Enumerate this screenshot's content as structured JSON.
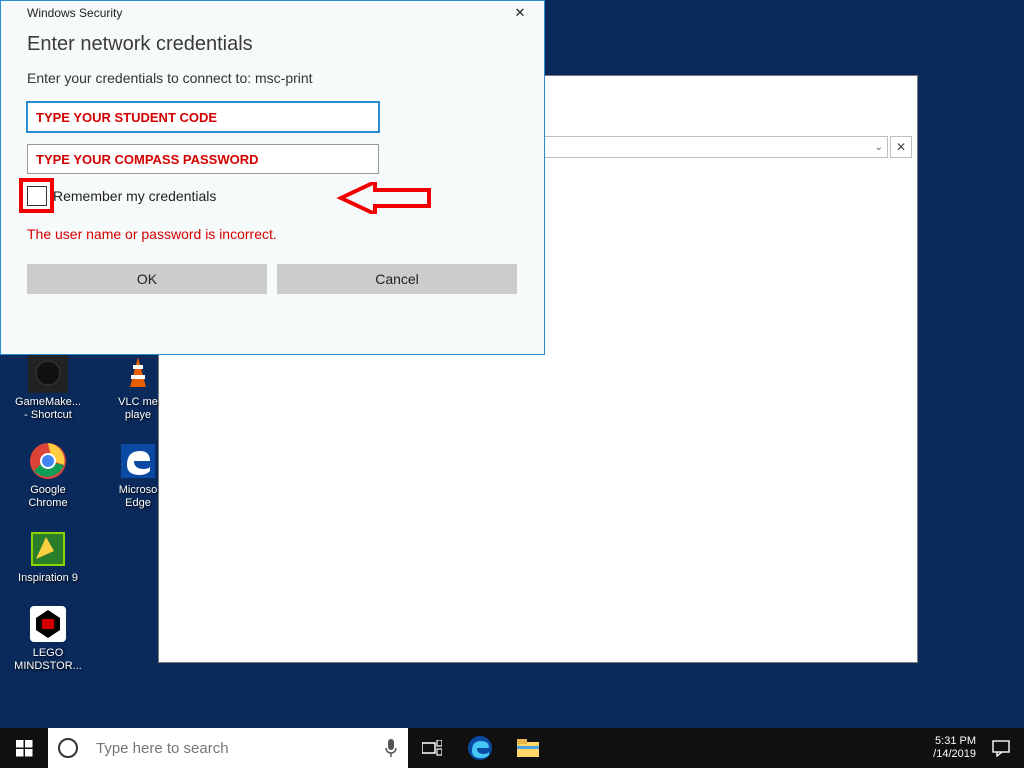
{
  "dialog": {
    "title": "Windows Security",
    "heading": "Enter network credentials",
    "subtext": "Enter your credentials to connect to: msc-print",
    "username_placeholder": "TYPE YOUR STUDENT CODE",
    "password_placeholder": "TYPE YOUR COMPASS PASSWORD",
    "remember_label": "Remember my credentials",
    "error": "The user name or password is incorrect.",
    "ok": "OK",
    "cancel": "Cancel"
  },
  "desktop": {
    "col1": [
      {
        "name": "GameMake...",
        "sub": "- Shortcut"
      },
      {
        "name": "Google",
        "sub": "Chrome"
      },
      {
        "name": "Inspiration 9",
        "sub": ""
      },
      {
        "name": "LEGO",
        "sub": "MINDSTOR..."
      }
    ],
    "col2": [
      {
        "name": "VLC me",
        "sub": "playe"
      },
      {
        "name": "Microso",
        "sub": "Edge"
      }
    ]
  },
  "taskbar": {
    "search_placeholder": "Type here to search",
    "time": "5:31 PM",
    "date": "/14/2019"
  }
}
